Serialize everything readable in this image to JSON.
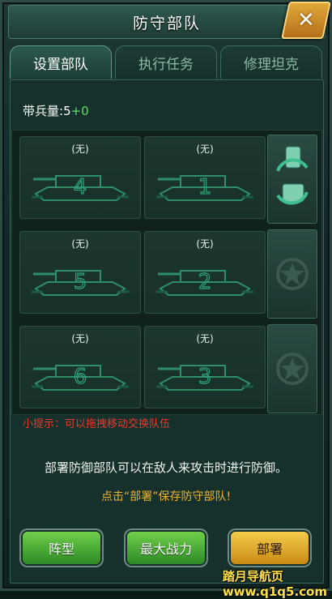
{
  "header": {
    "title": "防守部队",
    "close_icon": "close-icon"
  },
  "tabs": [
    {
      "label": "设置部队",
      "active": true
    },
    {
      "label": "执行任务",
      "active": false
    },
    {
      "label": "修理坦克",
      "active": false
    }
  ],
  "troops": {
    "label": "带兵量:",
    "base": "5",
    "bonus": "+0"
  },
  "slots": [
    {
      "status": "(无)",
      "number": "4"
    },
    {
      "status": "(无)",
      "number": "1"
    },
    {
      "status": "(无)",
      "number": "5"
    },
    {
      "status": "(无)",
      "number": "2"
    },
    {
      "status": "(无)",
      "number": "6"
    },
    {
      "status": "(无)",
      "number": "3"
    }
  ],
  "side_buttons": [
    {
      "icon": "swap-rotate-icon"
    },
    {
      "icon": "star-badge-icon"
    },
    {
      "icon": "star-badge-icon"
    }
  ],
  "hint": "小提示：可以拖拽移动交换队伍",
  "description": "部署防御部队可以在敌人来攻击时进行防御。",
  "call_to_action": "点击“部署”保存防守部队!",
  "buttons": {
    "formation": "阵型",
    "max_power": "最大战力",
    "deploy": "部署"
  },
  "watermark": {
    "line1": "踏月导航页",
    "line2": "www.q1q5.com"
  },
  "colors": {
    "accent_green": "#5fe06a",
    "hint_red": "#e53c2e",
    "cta_gold": "#e9b530"
  }
}
